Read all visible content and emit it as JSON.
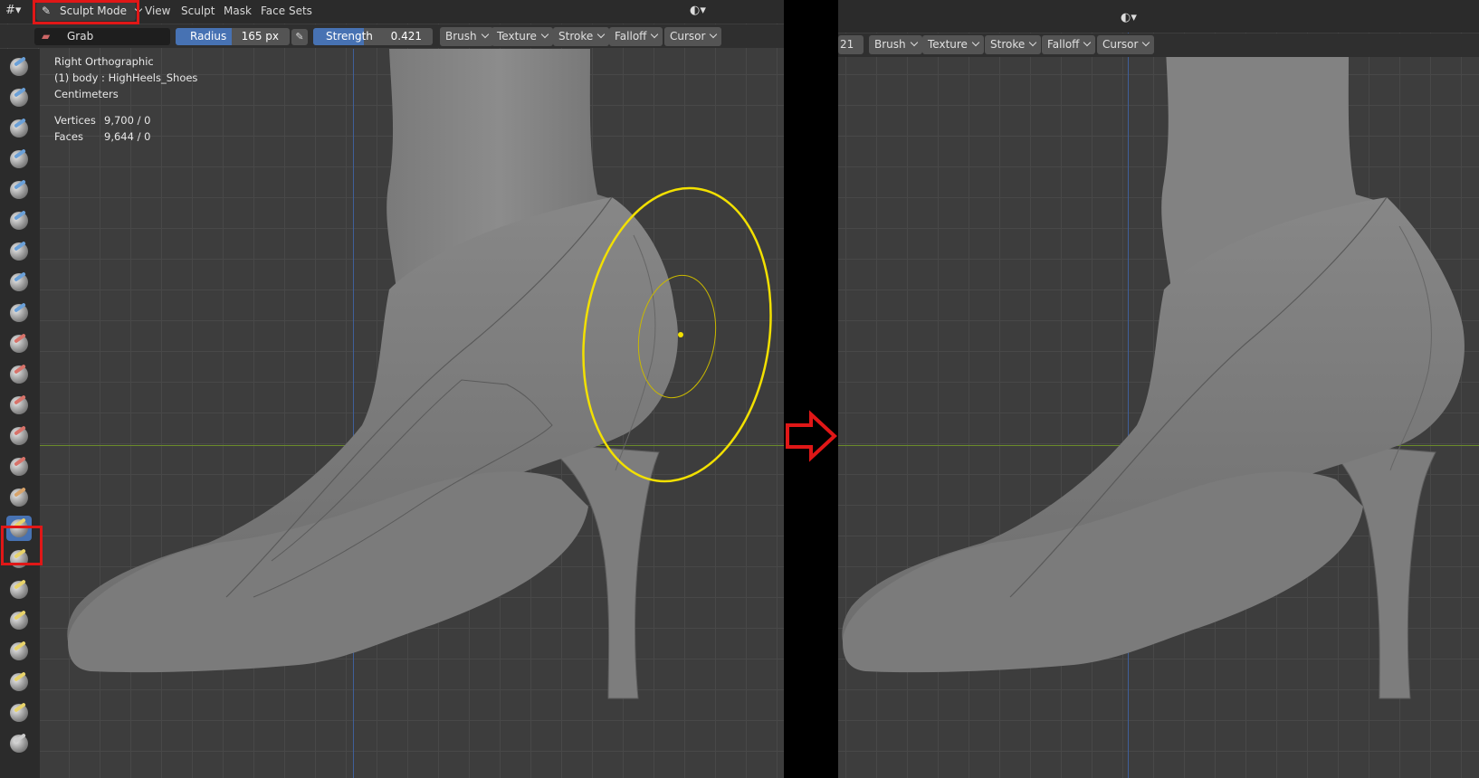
{
  "left": {
    "header": {
      "mode_label": "Sculpt Mode",
      "menus": [
        "View",
        "Sculpt",
        "Mask",
        "Face Sets"
      ]
    },
    "toolbar": {
      "brush_name": "Grab",
      "radius_label": "Radius",
      "radius_value": "165 px",
      "strength_label": "Strength",
      "strength_value": "0.421",
      "strength_fill": 0.421,
      "dropdowns": [
        "Brush",
        "Texture",
        "Stroke",
        "Falloff",
        "Cursor"
      ]
    },
    "viewport_info": {
      "view": "Right Orthographic",
      "object": "(1) body : HighHeels_Shoes",
      "units": "Centimeters",
      "vertices_label": "Vertices",
      "vertices_value": "9,700 / 0",
      "faces_label": "Faces",
      "faces_value": "9,644 / 0"
    },
    "tools": [
      "draw-brush",
      "draw-sharp-brush",
      "clay-brush",
      "clay-strips-brush",
      "clay-thumb-brush",
      "layer-brush",
      "inflate-brush",
      "blob-brush",
      "crease-brush",
      "smooth-brush",
      "flatten-brush",
      "fill-brush",
      "scrape-brush",
      "multiplane-scrape-brush",
      "pinch-brush",
      "grab-brush",
      "elastic-deform-brush",
      "snake-hook-brush",
      "thumb-brush",
      "pose-brush",
      "nudge-brush",
      "rotate-brush",
      "slide-relax-brush"
    ],
    "active_tool_index": 15
  },
  "right": {
    "partial_value": "21",
    "dropdowns": [
      "Brush",
      "Texture",
      "Stroke",
      "Falloff",
      "Cursor"
    ]
  },
  "colors": {
    "highlight": "#e01717",
    "slider_fill": "#4772b3",
    "cursor": "#f2e000"
  }
}
